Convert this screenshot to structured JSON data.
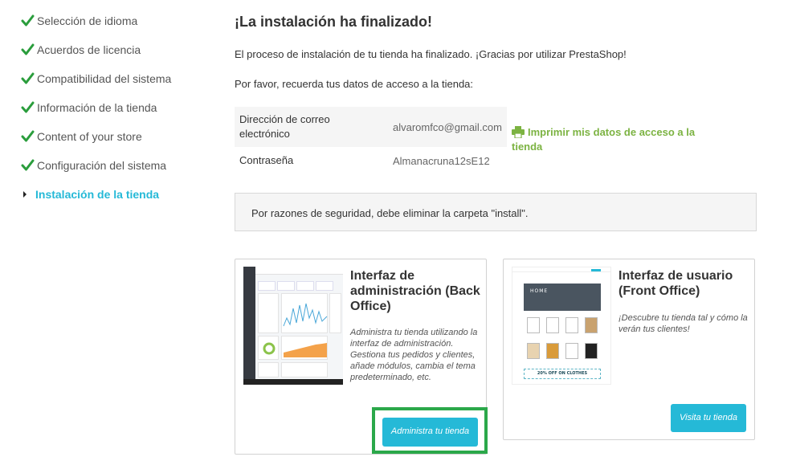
{
  "steps": [
    {
      "label": "Selección de idioma",
      "done": true
    },
    {
      "label": "Acuerdos de licencia",
      "done": true
    },
    {
      "label": "Compatibilidad del sistema",
      "done": true
    },
    {
      "label": "Información de la tienda",
      "done": true
    },
    {
      "label": "Content of your store",
      "done": true
    },
    {
      "label": "Configuración del sistema",
      "done": true
    },
    {
      "label": "Instalación de la tienda",
      "done": false,
      "current": true
    }
  ],
  "main": {
    "title": "¡La instalación ha finalizado!",
    "intro": "El proceso de instalación de tu tienda ha finalizado. ¡Gracias por utilizar PrestaShop!",
    "remember": "Por favor, recuerda tus datos de acceso a la tienda:",
    "credentials": {
      "email_label": "Dirección de correo electrónico",
      "email_value": "alvaromfco@gmail.com",
      "password_label": "Contraseña",
      "password_value": "Almanacruna12sE12"
    },
    "print_link": "Imprimir mis datos de acceso a la tienda",
    "security_notice": "Por razones de seguridad, debe eliminar la carpeta \"install\"."
  },
  "back_office": {
    "title": "Interfaz de administración (Back Office)",
    "description": "Administra tu tienda utilizando la interfaz de administración. Gestiona tus pedidos y clientes, añade módulos, cambia el tema predeterminado, etc.",
    "button": "Administra tu tienda"
  },
  "front_office": {
    "title": "Interfaz de usuario (Front Office)",
    "description": "¡Descubre tu tienda tal y cómo la verán tus clientes!",
    "button": "Visita tu tienda",
    "thumb_hero": "HOME",
    "thumb_banner": "20% OFF ON CLOTHES"
  },
  "colors": {
    "accent": "#25b9d7",
    "check": "#2a9d3c",
    "print": "#7cb342",
    "highlight": "#2ba84a"
  }
}
